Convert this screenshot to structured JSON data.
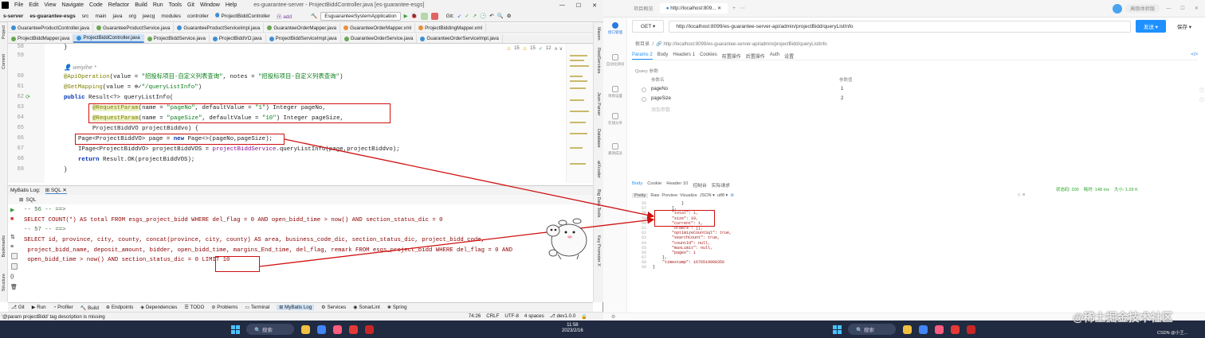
{
  "ide": {
    "menu": [
      "File",
      "Edit",
      "View",
      "Navigate",
      "Code",
      "Refactor",
      "Build",
      "Run",
      "Tools",
      "Git",
      "Window",
      "Help"
    ],
    "window_title": "es-guarantee-server - ProjectBiddController.java [es-guarantee-esgs]",
    "breadcrumb": [
      "s-server",
      "es-guarantee-esgs",
      "src",
      "main",
      "java",
      "org",
      "jeecg",
      "modules",
      "controller",
      "ProjectBiddController",
      "add"
    ],
    "run_config": "EsguaranteeSystemApplication",
    "git_label": "Git:",
    "tabs_row1": [
      {
        "label": "GuaranteeProductController.java",
        "color": "blue"
      },
      {
        "label": "GuaranteeProductService.java",
        "color": "green"
      },
      {
        "label": "GuaranteeProductServiceImpl.java",
        "color": "blue"
      },
      {
        "label": "GuaranteeOrderMapper.java",
        "color": "green"
      },
      {
        "label": "GuaranteeOrderMapper.xml",
        "color": "orange"
      },
      {
        "label": "ProjectBiddingMapper.xml",
        "color": "orange"
      }
    ],
    "tabs_row2": [
      {
        "label": "ProjectBiddMapper.java",
        "color": "green"
      },
      {
        "label": "ProjectBiddController.java",
        "color": "blue",
        "active": true
      },
      {
        "label": "ProjectBiddService.java",
        "color": "green"
      },
      {
        "label": "ProjectBiddVO.java",
        "color": "blue"
      },
      {
        "label": "ProjectBiddServiceImpl.java",
        "color": "blue"
      },
      {
        "label": "GuaranteeOrderService.java",
        "color": "green"
      },
      {
        "label": "GuaranteeOrderServiceImpl.java",
        "color": "blue"
      }
    ],
    "left_tools": [
      "Project",
      "Commit",
      "Bookmarks",
      "Structure"
    ],
    "right_tools": [
      "Maven",
      "RestServices",
      "Json Parser",
      "Database",
      "aiXcoder",
      "Big Data Tools",
      "Key Promoter X"
    ],
    "inspection": {
      "warnings": "15",
      "weak": "15",
      "typos": "12"
    },
    "line_numbers": [
      "58",
      "59",
      "",
      "60",
      "61",
      "62",
      "63",
      "64",
      "65",
      "66",
      "67",
      "68",
      "69"
    ],
    "author_hint": "weiyihe *",
    "code": {
      "l58": "}",
      "l60a": "@ApiOperation",
      "l60b": "(value = ",
      "l60c": "\"招投标项目-自定义列表查询\"",
      "l60d": ", notes = ",
      "l60e": "\"招投标项目-自定义列表查询\"",
      "l60f": ")",
      "l61a": "@GetMapping",
      "l61b": "(value = ",
      "l61c": "\"/queryListInfo\"",
      "l61d": ")",
      "l62a": "public ",
      "l62b": "Result<?> queryListInfo(",
      "l63a": "@RequestParam",
      "l63b": "(name = ",
      "l63c": "\"pageNo\"",
      "l63d": ", defaultValue = ",
      "l63e": "\"1\"",
      "l63f": ") Integer pageNo,",
      "l64a": "@RequestParam",
      "l64b": "(name = ",
      "l64c": "\"pageSize\"",
      "l64d": ", defaultValue = ",
      "l64e": "\"10\"",
      "l64f": ") Integer pageSize,",
      "l65": "ProjectBiddVO projectBiddvo) {",
      "l66a": "Page<ProjectBiddVO> page = ",
      "l66b": "new ",
      "l66c": "Page<>(pageNo,pageSize);",
      "l67a": "IPage<ProjectBiddVO> projectBiddVOS = ",
      "l67b": "projectBiddService",
      "l67c": ".queryListInfo(page,projectBiddvo);",
      "l68a": "return ",
      "l68b": "Result.OK(projectBiddVOS);",
      "l69": "}"
    },
    "mybatis": {
      "title": "MyBatis Log:",
      "tab": "SQL",
      "sql_tab": "SQL",
      "lines": [
        "-- 56 -- ==>",
        "SELECT COUNT(*) AS total FROM esgs_project_bidd WHERE del_flag = 0 AND open_bidd_time > now() AND section_status_dic = 0",
        "-- 57 -- ==>",
        "SELECT id, province, city, county, concat(province, city, county) AS area, business_code_dic, section_status_dic, project_bidd_code,",
        " project_bidd_name, deposit_amount, bidder, open_bidd_time, margins_End_time, del_flag, remark FROM esgs_project_bidd WHERE del_flag = 0 AND",
        " open_bidd_time > now() AND section_status_dic = 0 LIMIT 10"
      ]
    },
    "bottom_tools": [
      "Git",
      "Run",
      "Profiler",
      "Build",
      "Endpoints",
      "Dependencies",
      "TODO",
      "Problems",
      "Terminal",
      "MyBatis Log",
      "Services",
      "SonarLint",
      "Spring"
    ],
    "status_msg": "'@param projectBidd' tag description is missing",
    "status_right": [
      "74:26",
      "CRLF",
      "UTF-8",
      "4 spaces",
      "dev1.0.0"
    ]
  },
  "taskbar": {
    "search": "搜索",
    "time": "11:58",
    "date": "2023/2/16"
  },
  "postman": {
    "top_tabs": [
      "项目概览",
      "http://localhost:809..."
    ],
    "top_right": "高级体验版",
    "method": "GET",
    "url": "http://localhost:8099/es-guarantee-server-api/admin/projectBidd/queryListInfo",
    "send": "发送",
    "save": "保存",
    "breadcrumb_prefix": "根目录",
    "breadcrumb": "http://localhost:8099/es-guarantee-server-api/admin/projectBidd/queryListInfo",
    "req_tabs": [
      "Params 2",
      "Body",
      "Headers 1",
      "Cookies",
      "前置操作",
      "后置操作",
      "Auth",
      "设置"
    ],
    "query_label": "Query 参数",
    "param_head": [
      "参数名",
      "参数值"
    ],
    "params": [
      {
        "name": "pageNo",
        "value": "1"
      },
      {
        "name": "pageSize",
        "value": "2"
      }
    ],
    "add_param": "添加参数",
    "sidebar": [
      "接口管理",
      "自动化测试",
      "项目设置",
      "在线分享",
      "邀请成员"
    ],
    "res_tabs": [
      "Body",
      "Cookie",
      "Header 10",
      "控制台",
      "实际请求"
    ],
    "fmt_tabs": [
      "Pretty",
      "Raw",
      "Preview",
      "Visualize",
      "JSON",
      "utf8"
    ],
    "res_meta": {
      "status": "状态码: 200",
      "time": "耗时: 148 ms",
      "size": "大小: 1.29 K"
    },
    "json_lines": [
      {
        "n": "56",
        "t": "            }"
      },
      {
        "n": "57",
        "t": "        ],"
      },
      {
        "n": "58",
        "t": "        \"total\": 1,"
      },
      {
        "n": "59",
        "t": "        \"size\": 10,"
      },
      {
        "n": "60",
        "t": "        \"current\": 1,"
      },
      {
        "n": "61",
        "t": "        \"orders\": [],"
      },
      {
        "n": "62",
        "t": "        \"optimizeCountSql\": true,"
      },
      {
        "n": "63",
        "t": "        \"searchCount\": true,"
      },
      {
        "n": "64",
        "t": "        \"countId\": null,"
      },
      {
        "n": "65",
        "t": "        \"maxLimit\": null,"
      },
      {
        "n": "66",
        "t": "        \"pages\": 1"
      },
      {
        "n": "67",
        "t": "    },"
      },
      {
        "n": "68",
        "t": "    \"timestamp\": 1676519908356"
      },
      {
        "n": "69",
        "t": "}"
      }
    ]
  },
  "watermark": "@稀土掘金技术社区",
  "csdn": "CSDN @小王..."
}
